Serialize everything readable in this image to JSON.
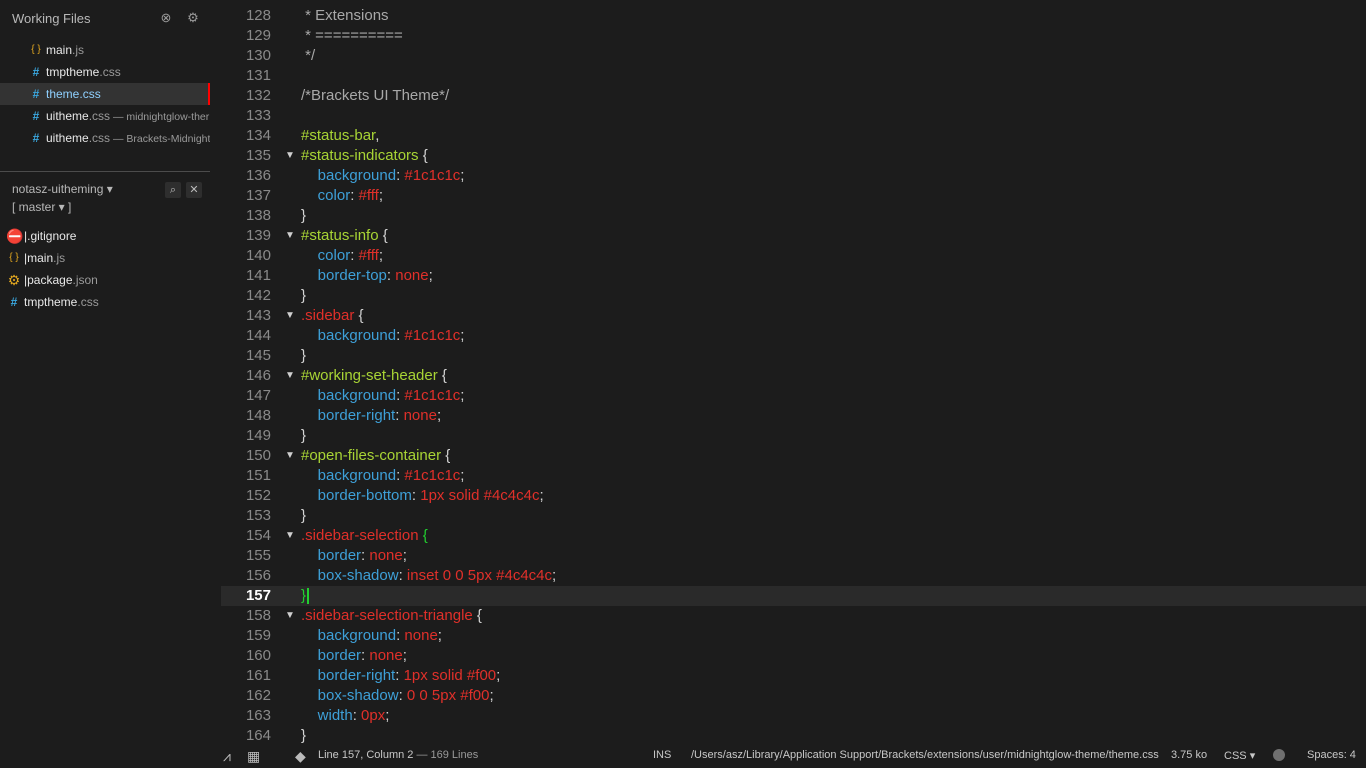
{
  "sidebar": {
    "working_files_title": "Working Files",
    "working_files": [
      {
        "icon": "{ }",
        "icon_name": "js-file-icon",
        "name": "main",
        "ext": ".js",
        "context": ""
      },
      {
        "icon": "#",
        "icon_name": "css-file-icon",
        "name": "tmptheme",
        "ext": ".css",
        "context": ""
      },
      {
        "icon": "#",
        "icon_name": "css-file-icon",
        "name": "theme",
        "ext": ".css",
        "context": "",
        "selected": true
      },
      {
        "icon": "#",
        "icon_name": "css-file-icon",
        "name": "uitheme",
        "ext": ".css",
        "context": " — midnightglow-ther"
      },
      {
        "icon": "#",
        "icon_name": "css-file-icon",
        "name": "uitheme",
        "ext": ".css",
        "context": " — Brackets-Midnightg"
      }
    ],
    "project": {
      "name": "notasz-uitheming ▾",
      "branch": "[ master ▾ ]",
      "files": [
        {
          "icon": "⛔",
          "icon_name": "gitignore-icon",
          "name": "|.gitignore",
          "ext": ""
        },
        {
          "icon": "{ }",
          "icon_name": "js-file-icon",
          "name": "|main",
          "ext": ".js"
        },
        {
          "icon": "⚙",
          "icon_name": "package-icon",
          "name": "|package",
          "ext": ".json"
        },
        {
          "icon": "#",
          "icon_name": "css-file-icon",
          "name": "tmptheme",
          "ext": ".css"
        }
      ]
    }
  },
  "editor": {
    "current_line": 157,
    "lines": [
      {
        "n": 128,
        "fold": false,
        "tokens": [
          [
            "c-cm",
            " * Extensions"
          ]
        ]
      },
      {
        "n": 129,
        "fold": false,
        "tokens": [
          [
            "c-cm",
            " * =========="
          ]
        ]
      },
      {
        "n": 130,
        "fold": false,
        "tokens": [
          [
            "c-cm",
            " */"
          ]
        ]
      },
      {
        "n": 131,
        "fold": false,
        "tokens": []
      },
      {
        "n": 132,
        "fold": false,
        "tokens": [
          [
            "c-cm",
            "/*Brackets UI Theme*/"
          ]
        ]
      },
      {
        "n": 133,
        "fold": false,
        "tokens": []
      },
      {
        "n": 134,
        "fold": false,
        "tokens": [
          [
            "c-id",
            "#status-bar"
          ],
          [
            "c-pn",
            ","
          ]
        ]
      },
      {
        "n": 135,
        "fold": true,
        "tokens": [
          [
            "c-id",
            "#status-indicators"
          ],
          [
            "c-pn",
            " {"
          ]
        ]
      },
      {
        "n": 136,
        "fold": false,
        "tokens": [
          [
            "c-pn",
            "    "
          ],
          [
            "c-pr",
            "background"
          ],
          [
            "c-pn",
            ": "
          ],
          [
            "c-vl",
            "#1c1c1c"
          ],
          [
            "c-pn",
            ";"
          ]
        ]
      },
      {
        "n": 137,
        "fold": false,
        "tokens": [
          [
            "c-pn",
            "    "
          ],
          [
            "c-pr",
            "color"
          ],
          [
            "c-pn",
            ": "
          ],
          [
            "c-vl",
            "#fff"
          ],
          [
            "c-pn",
            ";"
          ]
        ]
      },
      {
        "n": 138,
        "fold": false,
        "tokens": [
          [
            "c-pn",
            "}"
          ]
        ]
      },
      {
        "n": 139,
        "fold": true,
        "tokens": [
          [
            "c-id",
            "#status-info"
          ],
          [
            "c-pn",
            " {"
          ]
        ]
      },
      {
        "n": 140,
        "fold": false,
        "tokens": [
          [
            "c-pn",
            "    "
          ],
          [
            "c-pr",
            "color"
          ],
          [
            "c-pn",
            ": "
          ],
          [
            "c-vl",
            "#fff"
          ],
          [
            "c-pn",
            ";"
          ]
        ]
      },
      {
        "n": 141,
        "fold": false,
        "tokens": [
          [
            "c-pn",
            "    "
          ],
          [
            "c-pr",
            "border-top"
          ],
          [
            "c-pn",
            ": "
          ],
          [
            "c-vl",
            "none"
          ],
          [
            "c-pn",
            ";"
          ]
        ]
      },
      {
        "n": 142,
        "fold": false,
        "tokens": [
          [
            "c-pn",
            "}"
          ]
        ]
      },
      {
        "n": 143,
        "fold": true,
        "tokens": [
          [
            "c-cl",
            ".sidebar"
          ],
          [
            "c-pn",
            " {"
          ]
        ]
      },
      {
        "n": 144,
        "fold": false,
        "tokens": [
          [
            "c-pn",
            "    "
          ],
          [
            "c-pr",
            "background"
          ],
          [
            "c-pn",
            ": "
          ],
          [
            "c-vl",
            "#1c1c1c"
          ],
          [
            "c-pn",
            ";"
          ]
        ]
      },
      {
        "n": 145,
        "fold": false,
        "tokens": [
          [
            "c-pn",
            "}"
          ]
        ]
      },
      {
        "n": 146,
        "fold": true,
        "tokens": [
          [
            "c-id",
            "#working-set-header"
          ],
          [
            "c-pn",
            " {"
          ]
        ]
      },
      {
        "n": 147,
        "fold": false,
        "tokens": [
          [
            "c-pn",
            "    "
          ],
          [
            "c-pr",
            "background"
          ],
          [
            "c-pn",
            ": "
          ],
          [
            "c-vl",
            "#1c1c1c"
          ],
          [
            "c-pn",
            ";"
          ]
        ]
      },
      {
        "n": 148,
        "fold": false,
        "tokens": [
          [
            "c-pn",
            "    "
          ],
          [
            "c-pr",
            "border-right"
          ],
          [
            "c-pn",
            ": "
          ],
          [
            "c-vl",
            "none"
          ],
          [
            "c-pn",
            ";"
          ]
        ]
      },
      {
        "n": 149,
        "fold": false,
        "tokens": [
          [
            "c-pn",
            "}"
          ]
        ]
      },
      {
        "n": 150,
        "fold": true,
        "tokens": [
          [
            "c-id",
            "#open-files-container"
          ],
          [
            "c-pn",
            " {"
          ]
        ]
      },
      {
        "n": 151,
        "fold": false,
        "tokens": [
          [
            "c-pn",
            "    "
          ],
          [
            "c-pr",
            "background"
          ],
          [
            "c-pn",
            ": "
          ],
          [
            "c-vl",
            "#1c1c1c"
          ],
          [
            "c-pn",
            ";"
          ]
        ]
      },
      {
        "n": 152,
        "fold": false,
        "tokens": [
          [
            "c-pn",
            "    "
          ],
          [
            "c-pr",
            "border-bottom"
          ],
          [
            "c-pn",
            ": "
          ],
          [
            "c-vl",
            "1px solid #4c4c4c"
          ],
          [
            "c-pn",
            ";"
          ]
        ]
      },
      {
        "n": 153,
        "fold": false,
        "tokens": [
          [
            "c-pn",
            "}"
          ]
        ]
      },
      {
        "n": 154,
        "fold": true,
        "tokens": [
          [
            "c-cl",
            ".sidebar-selection"
          ],
          [
            "c-pn",
            " "
          ],
          [
            "c-br",
            "{"
          ]
        ]
      },
      {
        "n": 155,
        "fold": false,
        "tokens": [
          [
            "c-pn",
            "    "
          ],
          [
            "c-pr",
            "border"
          ],
          [
            "c-pn",
            ": "
          ],
          [
            "c-vl",
            "none"
          ],
          [
            "c-pn",
            ";"
          ]
        ]
      },
      {
        "n": 156,
        "fold": false,
        "tokens": [
          [
            "c-pn",
            "    "
          ],
          [
            "c-pr",
            "box-shadow"
          ],
          [
            "c-pn",
            ": "
          ],
          [
            "c-vl",
            "inset 0 0 5px #4c4c4c"
          ],
          [
            "c-pn",
            ";"
          ]
        ]
      },
      {
        "n": 157,
        "fold": false,
        "cursor": true,
        "tokens": [
          [
            "c-br",
            "}"
          ]
        ]
      },
      {
        "n": 158,
        "fold": true,
        "tokens": [
          [
            "c-cl",
            ".sidebar-selection-triangle"
          ],
          [
            "c-pn",
            " {"
          ]
        ]
      },
      {
        "n": 159,
        "fold": false,
        "tokens": [
          [
            "c-pn",
            "    "
          ],
          [
            "c-pr",
            "background"
          ],
          [
            "c-pn",
            ": "
          ],
          [
            "c-vl",
            "none"
          ],
          [
            "c-pn",
            ";"
          ]
        ]
      },
      {
        "n": 160,
        "fold": false,
        "tokens": [
          [
            "c-pn",
            "    "
          ],
          [
            "c-pr",
            "border"
          ],
          [
            "c-pn",
            ": "
          ],
          [
            "c-vl",
            "none"
          ],
          [
            "c-pn",
            ";"
          ]
        ]
      },
      {
        "n": 161,
        "fold": false,
        "tokens": [
          [
            "c-pn",
            "    "
          ],
          [
            "c-pr",
            "border-right"
          ],
          [
            "c-pn",
            ": "
          ],
          [
            "c-vl",
            "1px solid #f00"
          ],
          [
            "c-pn",
            ";"
          ]
        ]
      },
      {
        "n": 162,
        "fold": false,
        "tokens": [
          [
            "c-pn",
            "    "
          ],
          [
            "c-pr",
            "box-shadow"
          ],
          [
            "c-pn",
            ": "
          ],
          [
            "c-vl",
            "0 0 5px #f00"
          ],
          [
            "c-pn",
            ";"
          ]
        ]
      },
      {
        "n": 163,
        "fold": false,
        "tokens": [
          [
            "c-pn",
            "    "
          ],
          [
            "c-pr",
            "width"
          ],
          [
            "c-pn",
            ": "
          ],
          [
            "c-vl",
            "0px"
          ],
          [
            "c-pn",
            ";"
          ]
        ]
      },
      {
        "n": 164,
        "fold": false,
        "tokens": [
          [
            "c-pn",
            "}"
          ]
        ]
      }
    ]
  },
  "statusbar": {
    "position": "Line 157, Column 2",
    "line_count": " — 169 Lines",
    "mode": "INS",
    "path": "/Users/asz/Library/Application Support/Brackets/extensions/user/midnightglow-theme/theme.css",
    "size": "3.75 ko",
    "language": "CSS",
    "spaces": "Spaces:  4"
  },
  "colors": {
    "accent": "#ff0000",
    "selector_id": "#a8d435",
    "selector_class": "#e0302a",
    "property": "#3ea0d8",
    "value": "#e0302a",
    "bracket_match": "#22d030"
  }
}
